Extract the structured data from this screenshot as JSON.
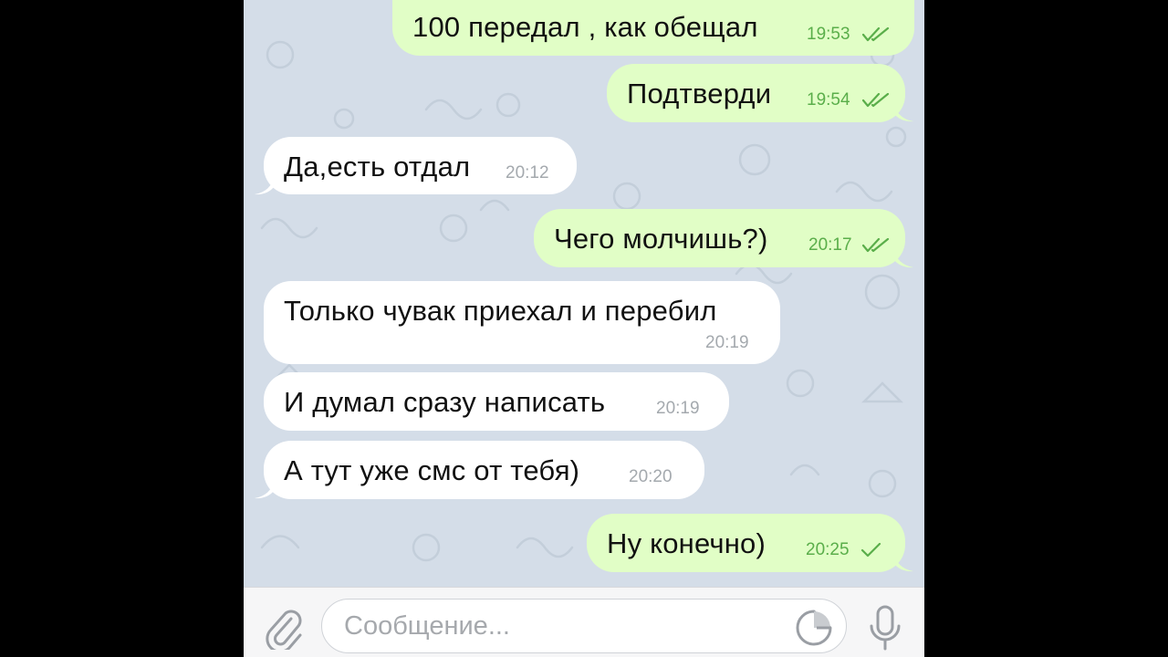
{
  "colors": {
    "outgoing_bubble": "#e1fec6",
    "incoming_bubble": "#ffffff",
    "outgoing_time": "#5aae4a",
    "incoming_time": "#a4a9ae",
    "chat_background": "#d4dde8",
    "input_bar": "#f6f6f7",
    "icon_gray": "#9a9ea4"
  },
  "messages": [
    {
      "direction": "out",
      "text": "100 передал , как обещал",
      "time": "19:53",
      "status": "read-double-check-icon"
    },
    {
      "direction": "out",
      "text": "Подтверди",
      "time": "19:54",
      "status": "read-double-check-icon"
    },
    {
      "direction": "in",
      "text": "Да,есть отдал",
      "time": "20:12"
    },
    {
      "direction": "out",
      "text": "Чего молчишь?)",
      "time": "20:17",
      "status": "read-double-check-icon"
    },
    {
      "direction": "in",
      "text": "Только чувак приехал и перебил",
      "time": "20:19"
    },
    {
      "direction": "in",
      "text": "И думал сразу написать",
      "time": "20:19"
    },
    {
      "direction": "in",
      "text": "А тут уже смс от тебя)",
      "time": "20:20"
    },
    {
      "direction": "out",
      "text": "Ну конечно)",
      "time": "20:25",
      "status": "sent-single-check-icon"
    }
  ],
  "input_bar": {
    "placeholder": "Сообщение...",
    "value": "",
    "attach_icon": "paperclip-icon",
    "sticker_icon": "sticker-icon",
    "mic_icon": "microphone-icon"
  }
}
